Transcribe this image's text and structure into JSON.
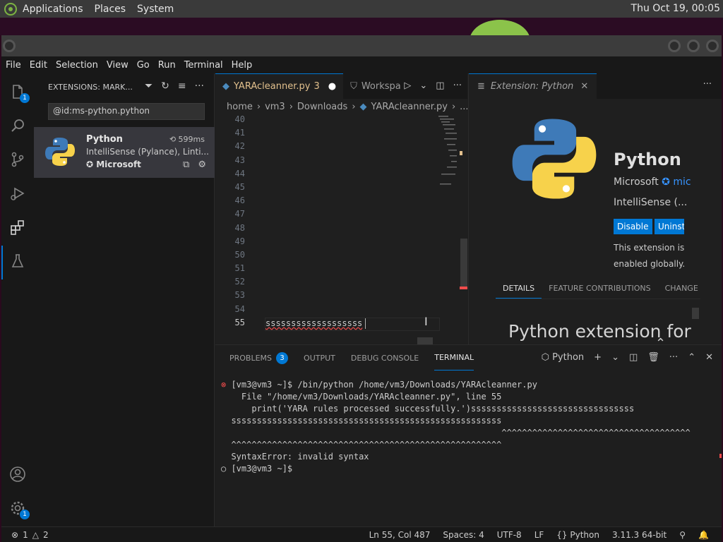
{
  "topbar": {
    "menus": [
      "Applications",
      "Places",
      "System"
    ],
    "clock": "Thu Oct 19, 00:05"
  },
  "menubar": [
    "File",
    "Edit",
    "Selection",
    "View",
    "Go",
    "Run",
    "Terminal",
    "Help"
  ],
  "activitybar": {
    "explorer_badge": "1",
    "settings_badge": "1"
  },
  "sidebar": {
    "header": "EXTENSIONS: MARK...",
    "search_value": "@id:ms-python.python",
    "extension": {
      "name": "Python",
      "time": "599ms",
      "description": "IntelliSense (Pylance), Linti...",
      "publisher": "Microsoft"
    }
  },
  "editor": {
    "tab_active": "YARAcleanner.py",
    "tab_active_problems": "3",
    "tab_other": "Workspa",
    "breadcrumb": [
      "home",
      "vm3",
      "Downloads",
      "YARAcleanner.py",
      "..."
    ],
    "line_numbers": [
      "40",
      "41",
      "42",
      "43",
      "44",
      "45",
      "46",
      "47",
      "48",
      "49",
      "50",
      "51",
      "52",
      "53",
      "54",
      "55"
    ],
    "current_line_text": "sssssssssssssssssss"
  },
  "ext_panel": {
    "tab": "Extension: Python",
    "title": "Python",
    "publisher": "Microsoft",
    "publisher_link": "mic",
    "short_desc": "IntelliSense (...",
    "btn_disable": "Disable",
    "btn_uninstall": "Uninstall",
    "status": "This extension is enabled globally.",
    "subtabs": [
      "DETAILS",
      "FEATURE CONTRIBUTIONS",
      "CHANGE"
    ],
    "readme_title": "Python extension for Visual Studio Code"
  },
  "panel": {
    "tabs": [
      "PROBLEMS",
      "OUTPUT",
      "DEBUG CONSOLE",
      "TERMINAL"
    ],
    "problems_count": "3",
    "terminal_name": "Python",
    "terminal_lines": [
      "⊗ [vm3@vm3 ~]$ /bin/python /home/vm3/Downloads/YARAcleanner.py",
      "    File \"/home/vm3/Downloads/YARAcleanner.py\", line 55",
      "      print('YARA rules processed successfully.')ssssssssssssssssssssssssssssssss",
      "  sssssssssssssssssssssssssssssssssssssssssssssssssssss",
      "                                                       ^^^^^^^^^^^^^^^^^^^^^^^^^^^^^^^^^^^^^",
      "  ^^^^^^^^^^^^^^^^^^^^^^^^^^^^^^^^^^^^^^^^^^^^^^^^^^^^^",
      "  SyntaxError: invalid syntax",
      "○ [vm3@vm3 ~]$"
    ]
  },
  "statusbar": {
    "errors": "1",
    "warnings": "2",
    "position": "Ln 55, Col 487",
    "spaces": "Spaces: 4",
    "encoding": "UTF-8",
    "eol": "LF",
    "language": "Python",
    "interpreter": "3.11.3 64-bit"
  },
  "colors": {
    "accent": "#0078d4",
    "modified_tab": "#e2c08d",
    "error_squiggle": "#f14c4c"
  }
}
